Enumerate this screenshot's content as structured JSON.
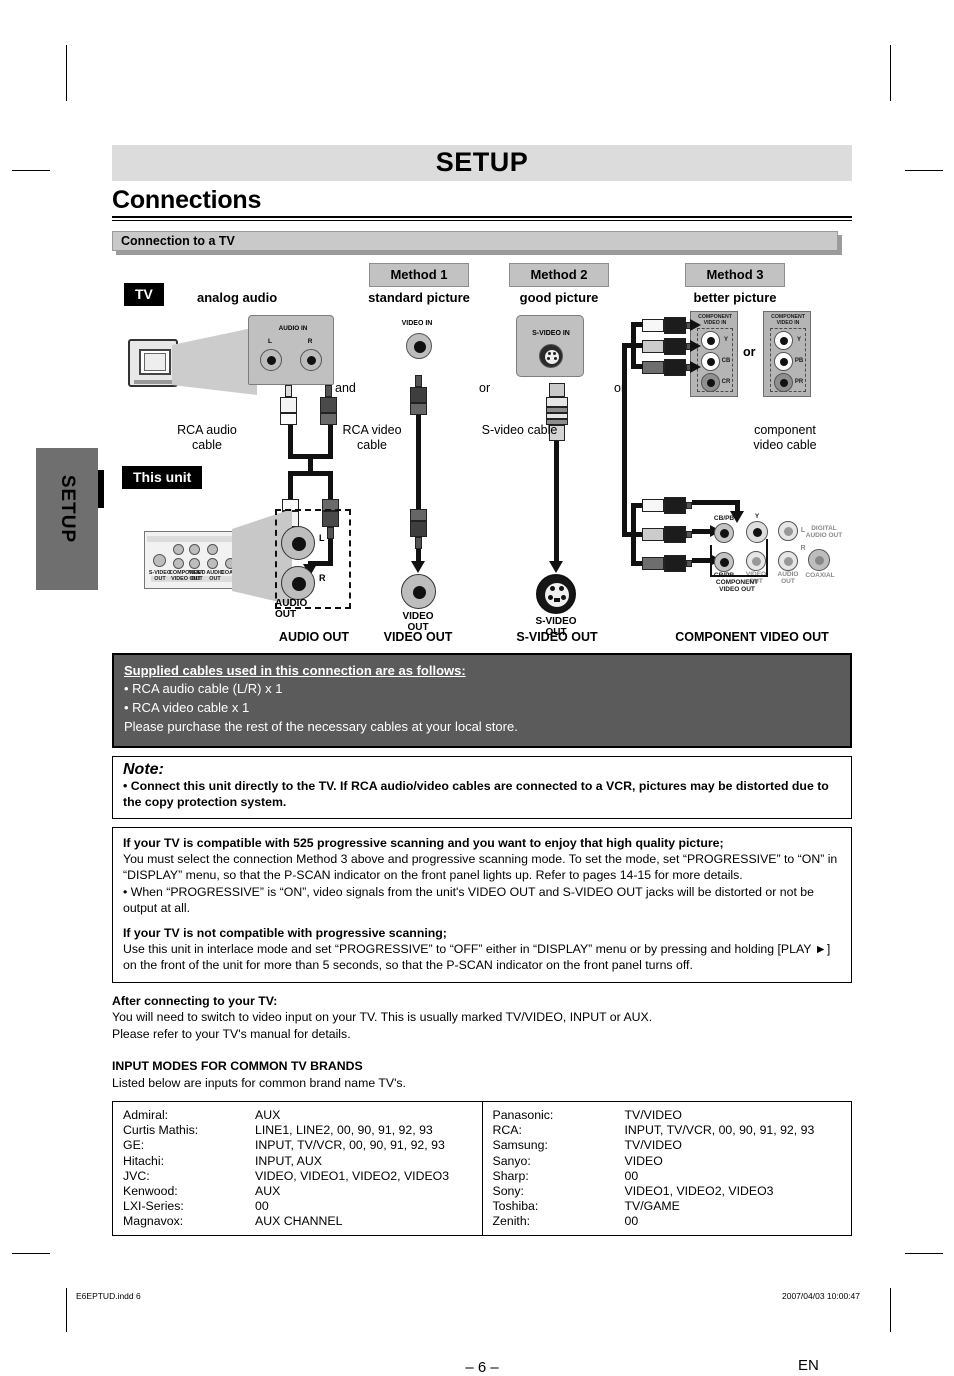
{
  "chapter": "SETUP",
  "section_title": "Connections",
  "subsection": "Connection to a TV",
  "side_tab": "SETUP",
  "diagram": {
    "tv_label": "TV",
    "this_unit_label": "This unit",
    "analog_audio": "analog audio",
    "methods": [
      {
        "box": "Method 1",
        "quality": "standard picture"
      },
      {
        "box": "Method 2",
        "quality": "good picture"
      },
      {
        "box": "Method 3",
        "quality": "better picture"
      }
    ],
    "conjunctions": {
      "and": "and",
      "or1": "or",
      "or2": "or",
      "or3": "or",
      "or_panels": "or"
    },
    "cables": [
      "RCA audio\ncable",
      "RCA video\ncable",
      "S-video cable",
      "component\nvideo cable"
    ],
    "cable_rca_audio": "RCA audio",
    "cable_rca_audio2": "cable",
    "cable_rca_video": "RCA video",
    "cable_rca_video2": "cable",
    "cable_svideo": "S-video cable",
    "cable_component": "component",
    "cable_component2": "video cable",
    "tv_inputs": {
      "audio_in": "AUDIO IN",
      "audio_in_l": "L",
      "audio_in_r": "R",
      "video_in": "VIDEO IN",
      "svideo_in": "S-VIDEO IN",
      "component_video_in": "COMPONENT\nVIDEO IN",
      "component_y": "Y",
      "component_cb": "CB",
      "component_cr": "CR",
      "component_y2": "Y",
      "component_pb": "PB",
      "component_pr": "PR"
    },
    "unit_outputs": {
      "audio_out": "AUDIO\nOUT",
      "audio_out_l": "L",
      "audio_out_r": "R",
      "video_out": "VIDEO\nOUT",
      "svideo_out": "S-VIDEO\nOUT",
      "component_video_out": "COMPONENT\nVIDEO OUT",
      "comp_y": "Y",
      "comp_cbpb": "CB/PB",
      "comp_crpr": "CR/PR",
      "digital_audio_out": "DIGITAL\nAUDIO OUT",
      "coaxial": "COAXIAL",
      "audio_out_small": "AUDIO\nOUT",
      "video_out_small": "VIDEO\nOUT",
      "svideo_out_small": "S-VIDEO\nOUT",
      "l": "L",
      "r": "R"
    },
    "bottom_labels": [
      "AUDIO OUT",
      "VIDEO OUT",
      "S-VIDEO OUT",
      "COMPONENT VIDEO OUT"
    ]
  },
  "supplied": {
    "heading": "Supplied cables used in this connection are as follows:",
    "items": [
      "• RCA audio cable (L/R) x 1",
      "• RCA video cable x 1"
    ],
    "footer": "Please purchase the rest of the necessary cables at your local store."
  },
  "note": {
    "title": "Note:",
    "body": "• Connect this unit directly to the TV. If RCA audio/video cables are connected to a VCR, pictures may be distorted due to the copy protection system."
  },
  "progressive": {
    "head1": "If your TV is compatible with 525 progressive scanning and you want to enjoy that high quality picture;",
    "para1": "You must select the connection Method 3 above and progressive scanning mode. To set the mode, set “PROGRESSIVE” to “ON” in “DISPLAY” menu, so that the P-SCAN indicator on the front panel lights up. Refer to pages 14-15 for more details.",
    "bullet1": "• When “PROGRESSIVE” is “ON”, video signals from the unit's VIDEO OUT and S-VIDEO OUT jacks will be distorted or not be output at all.",
    "head2": "If your TV is not compatible with progressive scanning;",
    "para2": "Use this unit in interlace mode and set “PROGRESSIVE” to “OFF” either in “DISPLAY” menu or by pressing and holding [PLAY ►] on the front of the unit for more than 5 seconds, so that the P-SCAN indicator on the front panel turns off."
  },
  "after_connecting": {
    "head": "After connecting to your TV:",
    "line1": "You will need to switch to video input on your TV. This is usually marked TV/VIDEO, INPUT or AUX.",
    "line2": "Please refer to your TV's manual for details."
  },
  "input_modes": {
    "head": "INPUT MODES FOR COMMON TV BRANDS",
    "line1": "Listed below are inputs for common brand name TV's."
  },
  "brands_left": [
    {
      "name": "Admiral:",
      "value": "AUX"
    },
    {
      "name": "Curtis Mathis:",
      "value": "LINE1, LINE2, 00, 90, 91, 92, 93"
    },
    {
      "name": "GE:",
      "value": "INPUT, TV/VCR, 00, 90, 91, 92, 93"
    },
    {
      "name": "Hitachi:",
      "value": "INPUT, AUX"
    },
    {
      "name": "JVC:",
      "value": "VIDEO, VIDEO1, VIDEO2, VIDEO3"
    },
    {
      "name": "Kenwood:",
      "value": "AUX"
    },
    {
      "name": "LXI-Series:",
      "value": "00"
    },
    {
      "name": "Magnavox:",
      "value": "AUX CHANNEL"
    }
  ],
  "brands_right": [
    {
      "name": "Panasonic:",
      "value": "TV/VIDEO"
    },
    {
      "name": "RCA:",
      "value": "INPUT, TV/VCR, 00, 90, 91, 92, 93"
    },
    {
      "name": "Samsung:",
      "value": "TV/VIDEO"
    },
    {
      "name": "Sanyo:",
      "value": "VIDEO"
    },
    {
      "name": "Sharp:",
      "value": "00"
    },
    {
      "name": "Sony:",
      "value": "VIDEO1, VIDEO2, VIDEO3"
    },
    {
      "name": "Toshiba:",
      "value": "TV/GAME"
    },
    {
      "name": "Zenith:",
      "value": "00"
    }
  ],
  "footer": {
    "page_number": "– 6 –",
    "language": "EN",
    "file": "E6EPTUD.indd   6",
    "timestamp": "2007/04/03   10:00:47"
  }
}
